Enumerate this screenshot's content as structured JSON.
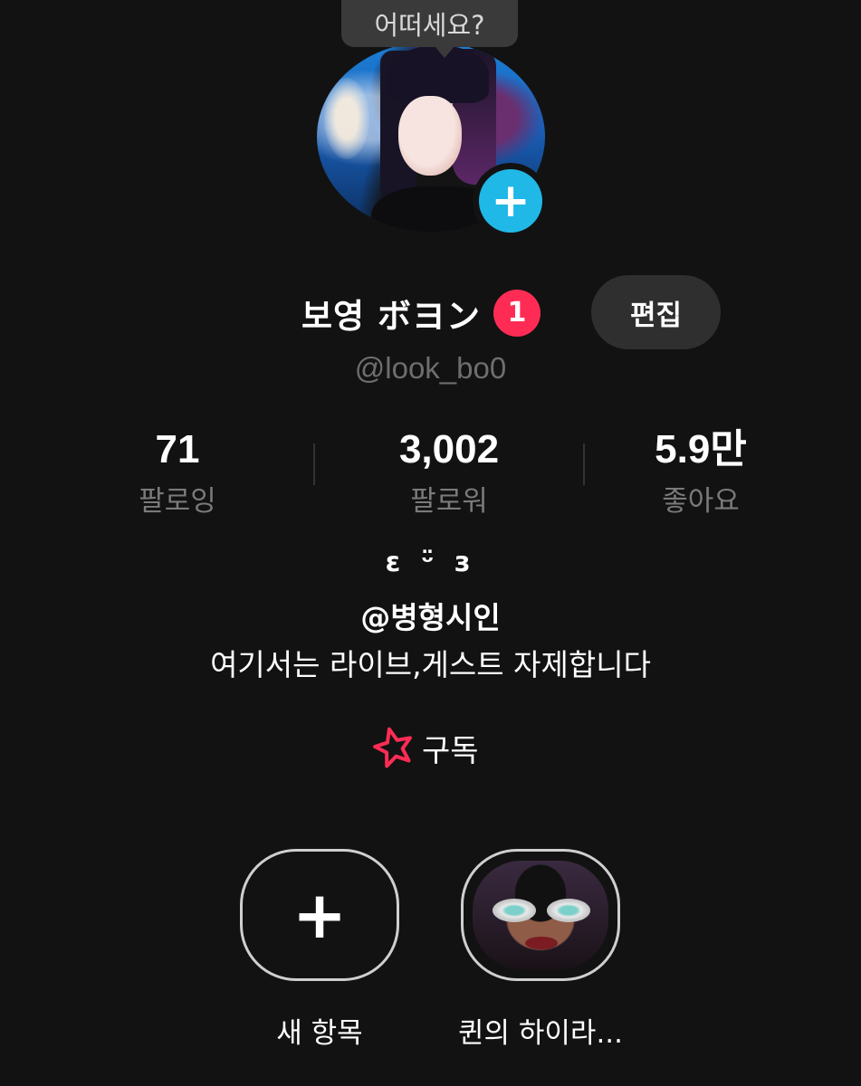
{
  "tooltip": {
    "text": "어떠세요?"
  },
  "profile": {
    "display_name": "보영 ボヨン",
    "notification_count": "1",
    "edit_label": "편집",
    "username": "@look_bo0"
  },
  "stats": [
    {
      "value": "71",
      "label": "팔로잉"
    },
    {
      "value": "3,002",
      "label": "팔로워"
    },
    {
      "value": "5.9만",
      "label": "좋아요"
    }
  ],
  "bio": {
    "emote": "ε ᵕ̈ з",
    "mention": "@병형시인",
    "text": "여기서는 라이브,게스트 자제합니다"
  },
  "subscribe": {
    "label": "구독",
    "icon": "star-icon",
    "icon_color": "#fe2c55"
  },
  "highlights": [
    {
      "label": "새 항목",
      "icon": "plus-icon"
    },
    {
      "label": "퀸의 하이라..."
    }
  ],
  "colors": {
    "background": "#121212",
    "accent_blue": "#20b8e6",
    "badge_red": "#fe2c55",
    "secondary_text": "#7a7a7a"
  }
}
